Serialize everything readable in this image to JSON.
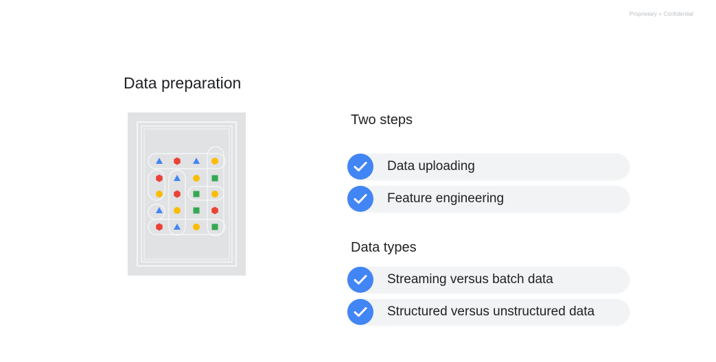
{
  "header": {
    "confidential_label": "Proprietary + Confidential"
  },
  "slide": {
    "title": "Data preparation",
    "sections": [
      {
        "heading": "Two steps",
        "items": [
          {
            "label": "Data uploading"
          },
          {
            "label": "Feature engineering"
          }
        ]
      },
      {
        "heading": "Data types",
        "items": [
          {
            "label": "Streaming versus batch data"
          },
          {
            "label": "Structured versus unstructured data"
          }
        ]
      }
    ]
  },
  "illustration": {
    "grid": [
      [
        "blue-triangle",
        "red-hexagon",
        "blue-triangle",
        "yellow-circle"
      ],
      [
        "red-hexagon",
        "blue-triangle",
        "yellow-circle",
        "green-square"
      ],
      [
        "yellow-circle",
        "red-hexagon",
        "green-square",
        "yellow-circle"
      ],
      [
        "blue-triangle",
        "yellow-circle",
        "green-square",
        "red-hexagon"
      ],
      [
        "red-hexagon",
        "blue-triangle",
        "yellow-circle",
        "green-square"
      ]
    ]
  },
  "colors": {
    "check_blue": "#4285f4",
    "pill_bg": "#f1f3f4",
    "red": "#ea4335",
    "blue": "#4285f4",
    "yellow": "#fbbc04",
    "green": "#34a853",
    "text": "#202124"
  },
  "icons": {
    "check": "check-icon"
  }
}
